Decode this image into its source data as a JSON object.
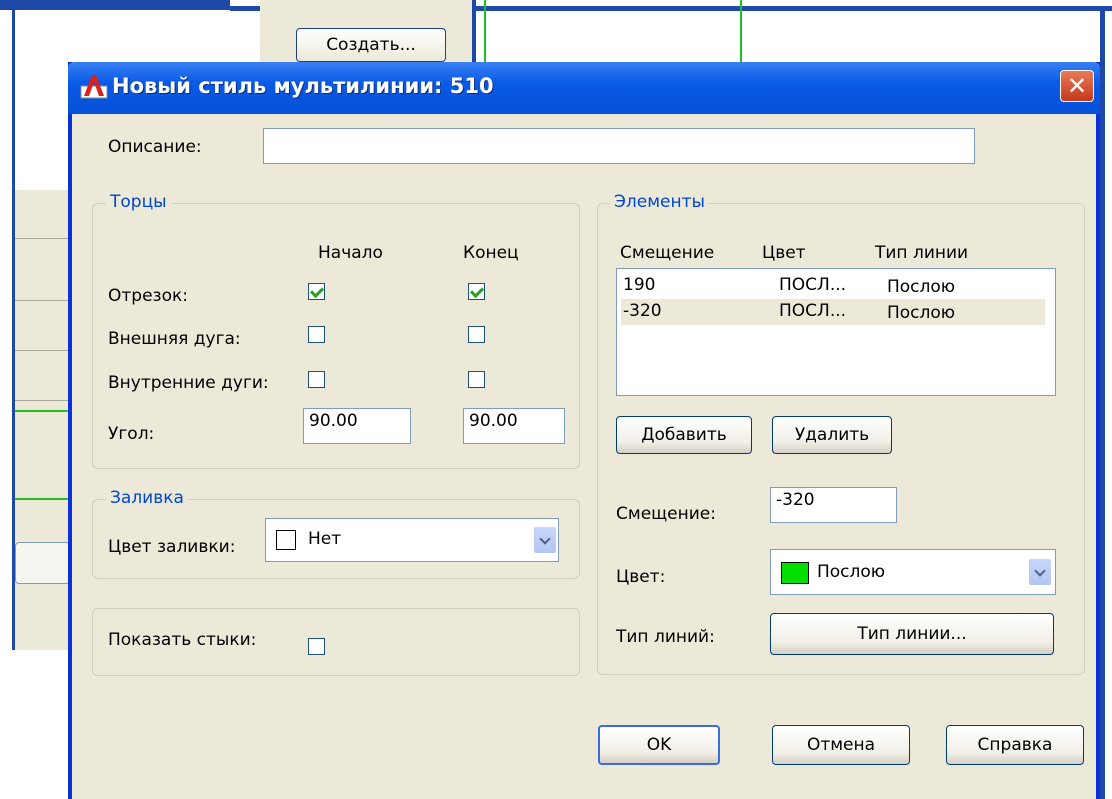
{
  "background": {
    "create_button": "Создать..."
  },
  "dialog": {
    "title": "Новый стиль мультилинии: 510",
    "close_symbol": "✕",
    "description_label": "Описание:",
    "description_value": "",
    "caps": {
      "legend": "Торцы",
      "start_header": "Начало",
      "end_header": "Конец",
      "rows": [
        {
          "label": "Отрезок:",
          "start_checked": true,
          "end_checked": true
        },
        {
          "label": "Внешняя дуга:",
          "start_checked": false,
          "end_checked": false
        },
        {
          "label": "Внутренние дуги:",
          "start_checked": false,
          "end_checked": false
        }
      ],
      "angle_label": "Угол:",
      "angle_start": "90.00",
      "angle_end": "90.00"
    },
    "fill": {
      "legend": "Заливка",
      "color_label": "Цвет заливки:",
      "color_value": "Нет",
      "swatch_color": "#ffffff"
    },
    "show_joints_label": "Показать стыки:",
    "elements": {
      "legend": "Элементы",
      "headers": [
        "Смещение",
        "Цвет",
        "Тип линии"
      ],
      "rows": [
        {
          "offset": "190",
          "color": "ПОСЛ...",
          "linetype": "Послою"
        },
        {
          "offset": "-320",
          "color": "ПОСЛ...",
          "linetype": "Послою"
        }
      ],
      "add_button": "Добавить",
      "delete_button": "Удалить",
      "offset_label": "Смещение:",
      "offset_value": "-320",
      "color_label": "Цвет:",
      "color_value": "Послою",
      "color_swatch": "#00e000",
      "linetype_label": "Тип линий:",
      "linetype_button": "Тип линии..."
    },
    "buttons": {
      "ok": "OK",
      "cancel": "Отмена",
      "help": "Справка"
    }
  }
}
